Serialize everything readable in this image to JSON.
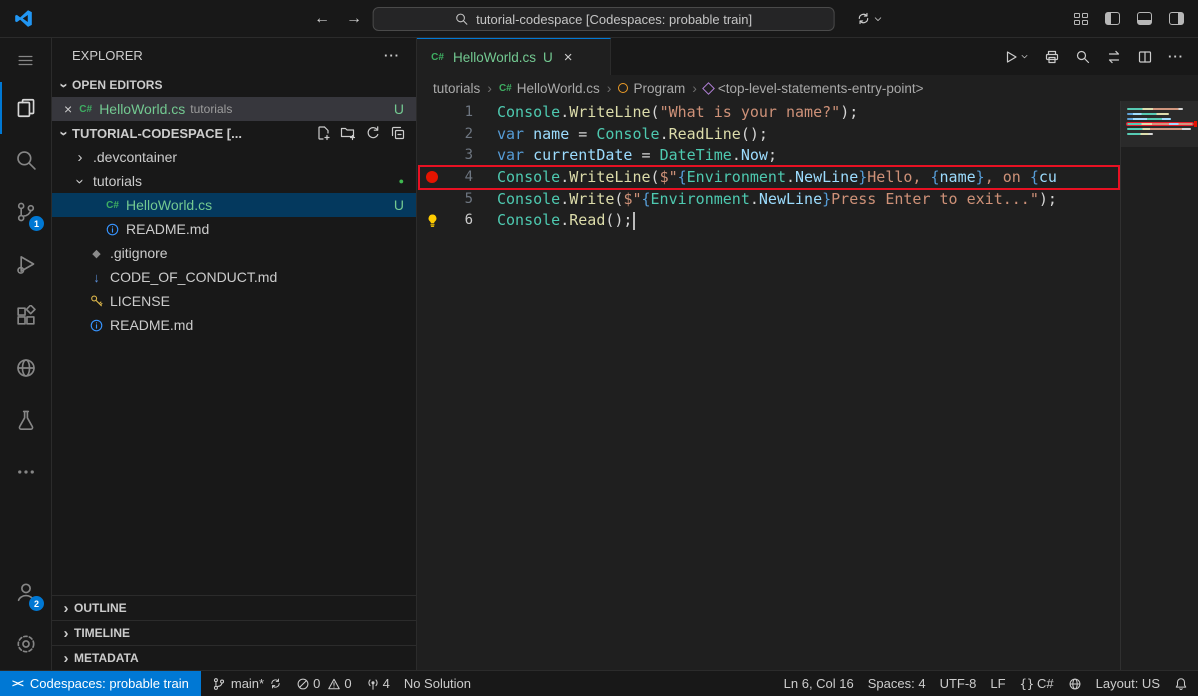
{
  "colors": {
    "accent": "#0078d4",
    "git_green": "#73c991",
    "selection_blue": "#04395e",
    "breakpoint_red": "#e51400",
    "annotation_red": "#e81123"
  },
  "icons": {
    "close": "×",
    "more": "···",
    "chevron": "›",
    "diamond": "◆",
    "down_arrow": "↓",
    "dot": "●",
    "csharp": "C#",
    "braces": "{}",
    "remote": "><",
    "back": "←",
    "forward": "→"
  },
  "titlebar": {
    "command_center": "tutorial-codespace [Codespaces: probable train]"
  },
  "activity": {
    "scm_badge": "1",
    "account_badge": "2"
  },
  "sidebar": {
    "title": "EXPLORER",
    "open_editors_label": "OPEN EDITORS",
    "open_editor": {
      "file": "HelloWorld.cs",
      "folder": "tutorials",
      "badge": "U"
    },
    "root_label": "TUTORIAL-CODESPACE [...",
    "tree": [
      {
        "label": ".devcontainer"
      },
      {
        "label": "tutorials"
      },
      {
        "label": "HelloWorld.cs",
        "badge": "U"
      },
      {
        "label": "README.md"
      },
      {
        "label": ".gitignore"
      },
      {
        "label": "CODE_OF_CONDUCT.md"
      },
      {
        "label": "LICENSE"
      },
      {
        "label": "README.md"
      }
    ],
    "sections": [
      {
        "label": "OUTLINE"
      },
      {
        "label": "TIMELINE"
      },
      {
        "label": "METADATA"
      }
    ]
  },
  "editor": {
    "tab": {
      "label": "HelloWorld.cs",
      "badge": "U"
    },
    "breadcrumbs": [
      {
        "label": "tutorials"
      },
      {
        "label": "HelloWorld.cs"
      },
      {
        "label": "Program"
      },
      {
        "label": "<top-level-statements-entry-point>"
      }
    ],
    "lines": [
      {
        "n": "1",
        "tokens": [
          {
            "t": "Console",
            "c": "cls"
          },
          {
            "t": ".",
            "c": "pun"
          },
          {
            "t": "WriteLine",
            "c": "fn"
          },
          {
            "t": "(",
            "c": "pun"
          },
          {
            "t": "\"What is your name?\"",
            "c": "str"
          },
          {
            "t": ");",
            "c": "pun"
          }
        ]
      },
      {
        "n": "2",
        "tokens": [
          {
            "t": "var ",
            "c": "kw"
          },
          {
            "t": "name",
            "c": "var"
          },
          {
            "t": " = ",
            "c": "pun"
          },
          {
            "t": "Console",
            "c": "cls"
          },
          {
            "t": ".",
            "c": "pun"
          },
          {
            "t": "ReadLine",
            "c": "fn"
          },
          {
            "t": "();",
            "c": "pun"
          }
        ]
      },
      {
        "n": "3",
        "tokens": [
          {
            "t": "var ",
            "c": "kw"
          },
          {
            "t": "currentDate",
            "c": "var"
          },
          {
            "t": " = ",
            "c": "pun"
          },
          {
            "t": "DateTime",
            "c": "cls"
          },
          {
            "t": ".",
            "c": "pun"
          },
          {
            "t": "Now",
            "c": "var"
          },
          {
            "t": ";",
            "c": "pun"
          }
        ]
      },
      {
        "n": "4",
        "tokens": [
          {
            "t": "Console",
            "c": "cls"
          },
          {
            "t": ".",
            "c": "pun"
          },
          {
            "t": "WriteLine",
            "c": "fn"
          },
          {
            "t": "(",
            "c": "pun"
          },
          {
            "t": "$\"",
            "c": "str"
          },
          {
            "t": "{",
            "c": "brace"
          },
          {
            "t": "Environment",
            "c": "cls"
          },
          {
            "t": ".",
            "c": "pun"
          },
          {
            "t": "NewLine",
            "c": "var"
          },
          {
            "t": "}",
            "c": "brace"
          },
          {
            "t": "Hello, ",
            "c": "str"
          },
          {
            "t": "{",
            "c": "brace"
          },
          {
            "t": "name",
            "c": "var"
          },
          {
            "t": "}",
            "c": "brace"
          },
          {
            "t": ", on ",
            "c": "str"
          },
          {
            "t": "{",
            "c": "brace"
          },
          {
            "t": "cu",
            "c": "var"
          }
        ]
      },
      {
        "n": "5",
        "tokens": [
          {
            "t": "Console",
            "c": "cls"
          },
          {
            "t": ".",
            "c": "pun"
          },
          {
            "t": "Write",
            "c": "fn"
          },
          {
            "t": "(",
            "c": "pun"
          },
          {
            "t": "$\"",
            "c": "str"
          },
          {
            "t": "{",
            "c": "brace"
          },
          {
            "t": "Environment",
            "c": "cls"
          },
          {
            "t": ".",
            "c": "pun"
          },
          {
            "t": "NewLine",
            "c": "var"
          },
          {
            "t": "}",
            "c": "brace"
          },
          {
            "t": "Press Enter to exit...\"",
            "c": "str"
          },
          {
            "t": ");",
            "c": "pun"
          }
        ]
      },
      {
        "n": "6",
        "tokens": [
          {
            "t": "Console",
            "c": "cls"
          },
          {
            "t": ".",
            "c": "pun"
          },
          {
            "t": "Read",
            "c": "fn"
          },
          {
            "t": "();",
            "c": "pun"
          }
        ]
      }
    ]
  },
  "status": {
    "remote": "Codespaces: probable train",
    "branch": "main*",
    "errors": "0",
    "warnings": "0",
    "ports": "4",
    "solution": "No Solution",
    "cursor": "Ln 6, Col 16",
    "indent": "Spaces: 4",
    "encoding": "UTF-8",
    "eol": "LF",
    "language": "C#",
    "layout": "Layout: US"
  }
}
